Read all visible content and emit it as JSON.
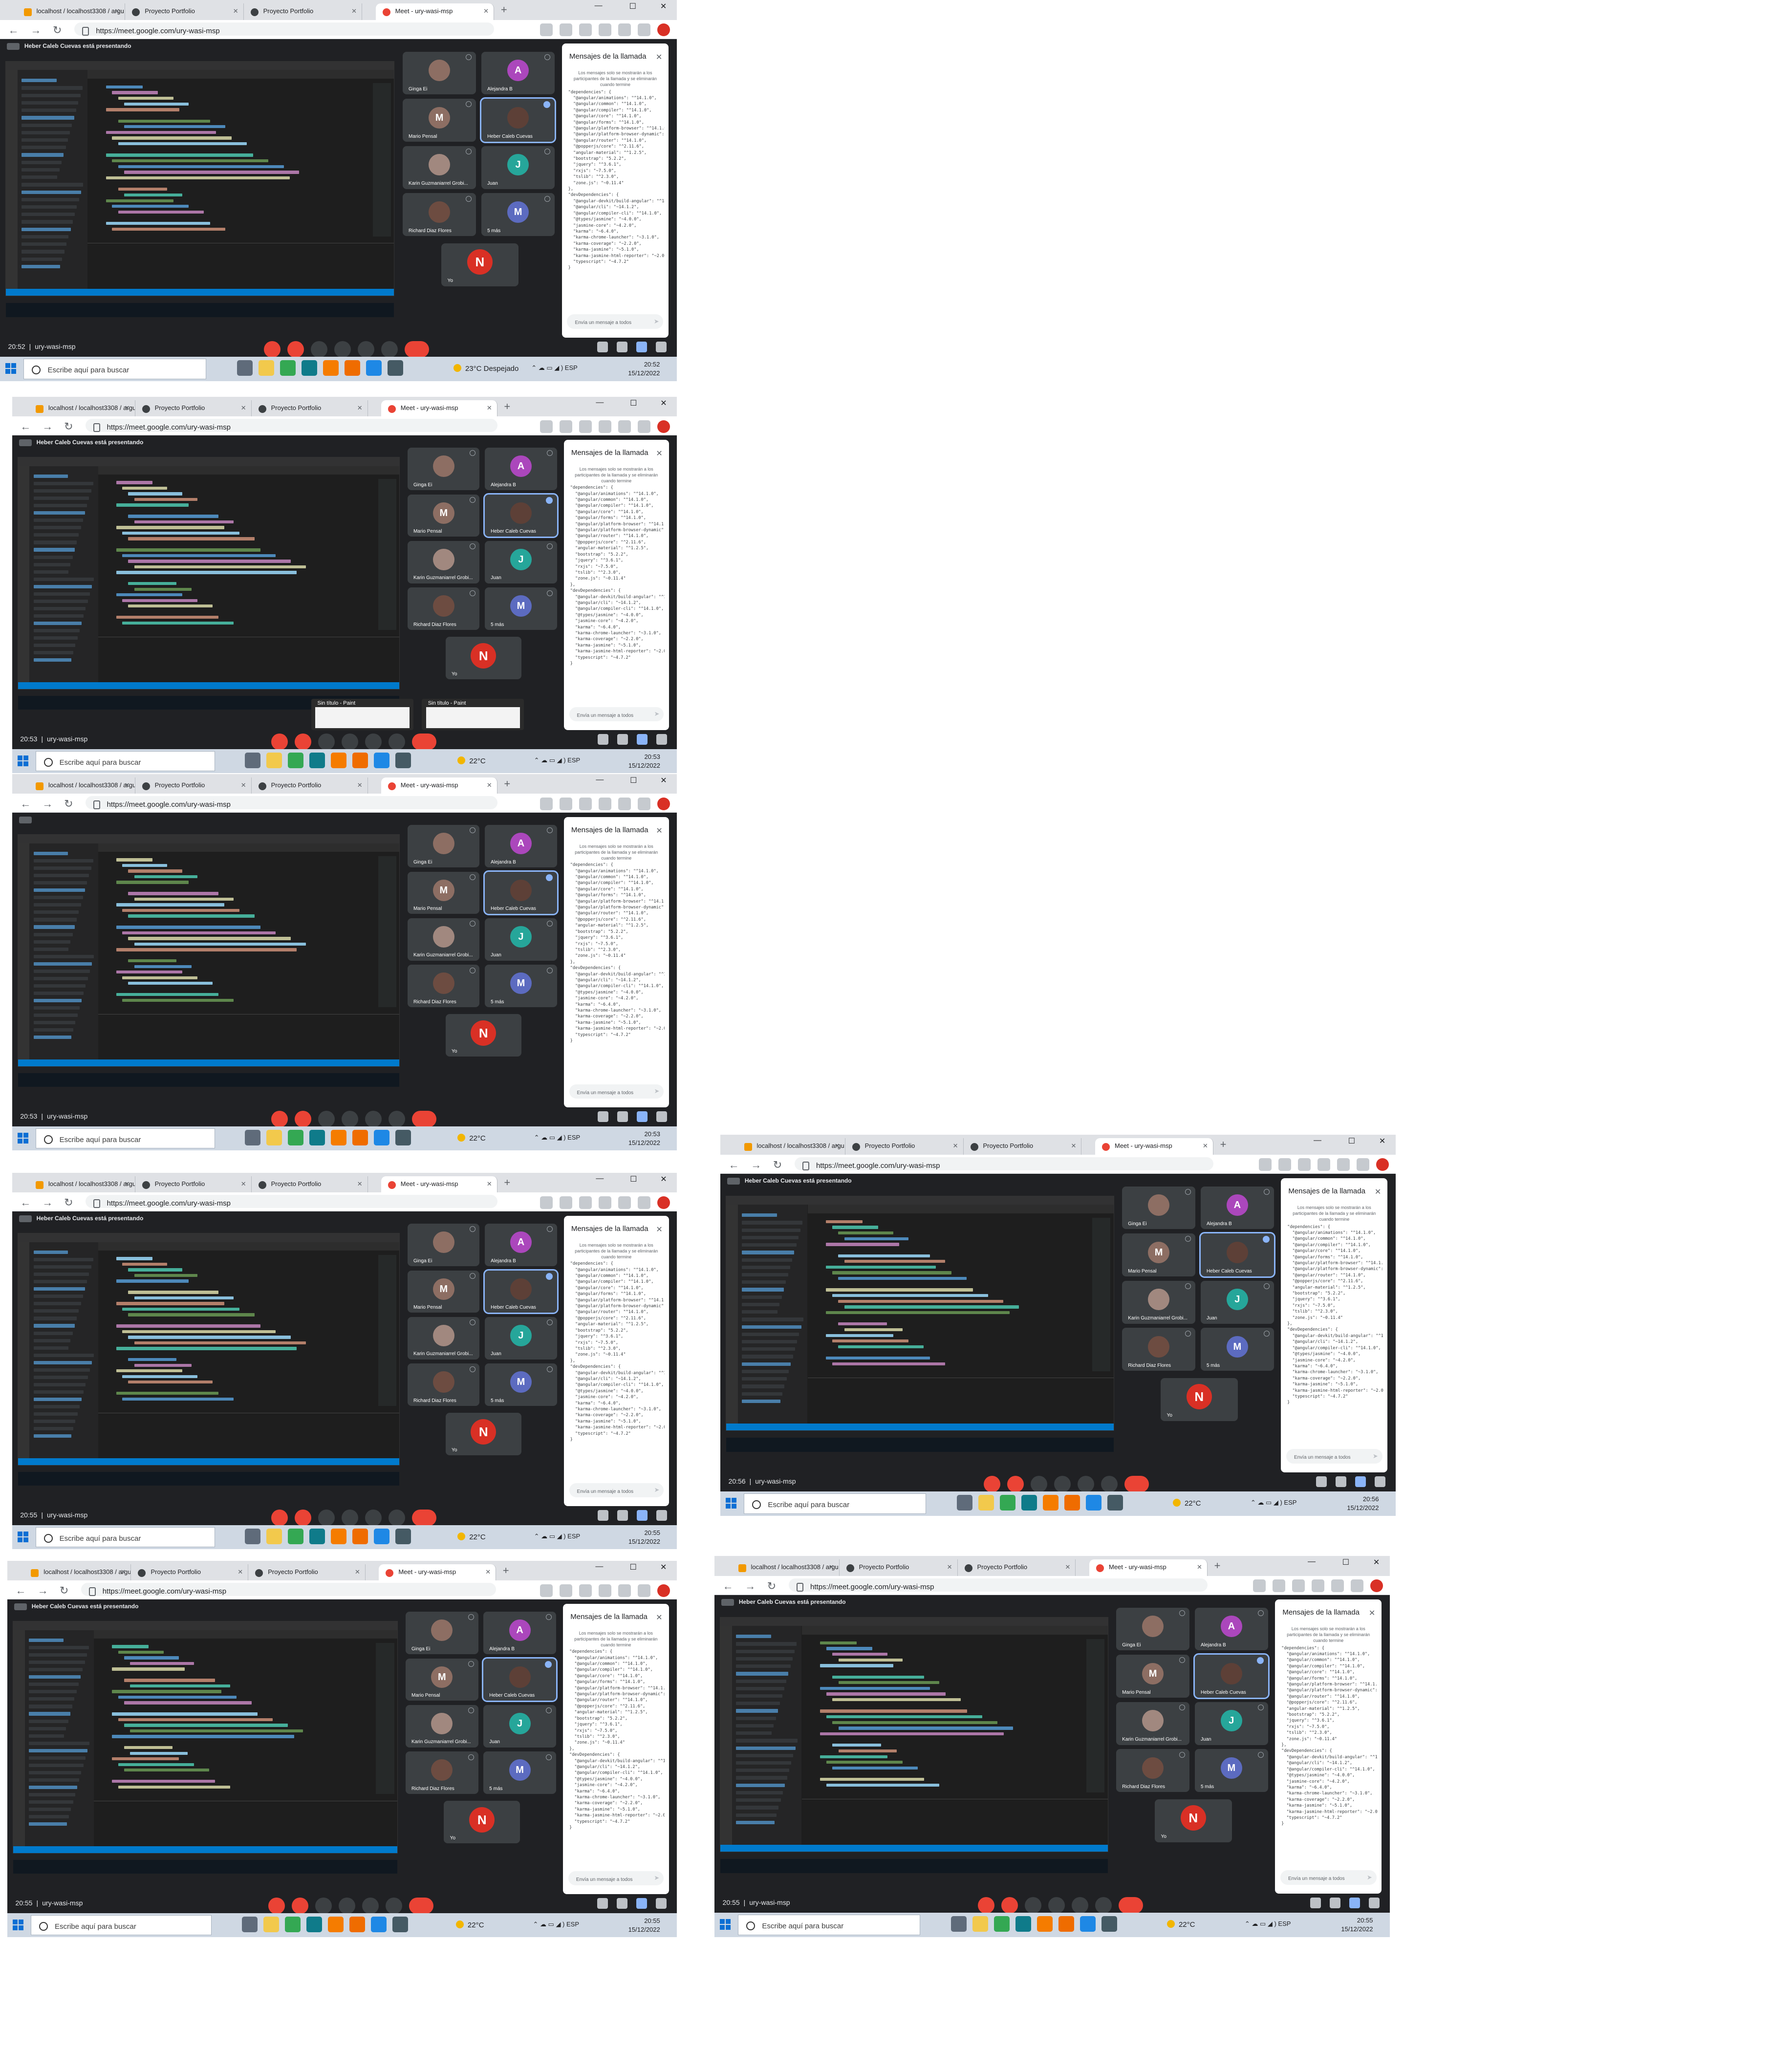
{
  "shots": [
    {
      "tabs": [
        "localhost / localhost3308 / argu",
        "Proyecto Portfolio",
        "Proyecto Portfolio",
        "Meet - ury-wasi-msp"
      ],
      "url": "https://meet.google.com/ury-wasi-msp",
      "presenter": "Heber Caleb Cuevas está presentando",
      "participants": [
        {
          "name": "Ginga Ei",
          "initial": "",
          "color": "#8d6e63"
        },
        {
          "name": "Alejandra B",
          "initial": "A",
          "color": "#ab47bc"
        },
        {
          "name": "Mario Pensal",
          "initial": "M",
          "color": "#8d6e63"
        },
        {
          "name": "Heber Caleb Cuevas",
          "initial": "",
          "color": "#5d4037"
        },
        {
          "name": "Karin Guzmaniarrel Grobi...",
          "initial": "",
          "color": "#a1887f"
        },
        {
          "name": "Juan",
          "initial": "J",
          "color": "#26a69a"
        },
        {
          "name": "Richard Diaz Flores",
          "initial": "",
          "color": "#6d4c41"
        },
        {
          "name": "5 más",
          "initial": "M",
          "color": "#5c6bc0"
        }
      ],
      "self": {
        "initial": "N",
        "name": "Yo"
      },
      "time": "20:52",
      "meeting_code": "ury-wasi-msp",
      "clock_time": "20:52",
      "clock_date": "15/12/2022",
      "weather": "23°C  Despejado",
      "lang": "ESP",
      "paint": []
    },
    {
      "tabs": [
        "localhost / localhost3308 / argu",
        "Proyecto Portfolio",
        "Proyecto Portfolio",
        "Meet - ury-wasi-msp"
      ],
      "url": "https://meet.google.com/ury-wasi-msp",
      "presenter": "Heber Caleb Cuevas está presentando",
      "participants": [
        {
          "name": "Ginga Ei",
          "initial": "",
          "color": "#8d6e63"
        },
        {
          "name": "Alejandra B",
          "initial": "A",
          "color": "#ab47bc"
        },
        {
          "name": "Mario Pensal",
          "initial": "M",
          "color": "#8d6e63"
        },
        {
          "name": "Heber Caleb Cuevas",
          "initial": "",
          "color": "#5d4037"
        },
        {
          "name": "Karin Guzmaniarrel Grobi...",
          "initial": "",
          "color": "#a1887f"
        },
        {
          "name": "Juan",
          "initial": "J",
          "color": "#26a69a"
        },
        {
          "name": "Richard Diaz Flores",
          "initial": "",
          "color": "#6d4c41"
        },
        {
          "name": "5 más",
          "initial": "M",
          "color": "#5c6bc0"
        }
      ],
      "self": {
        "initial": "N",
        "name": "Yo"
      },
      "time": "20:53",
      "meeting_code": "ury-wasi-msp",
      "clock_time": "20:53",
      "clock_date": "15/12/2022",
      "weather": "22°C",
      "lang": "ESP",
      "paint": [
        "Sin título - Paint",
        "Sin título - Paint"
      ]
    },
    {
      "tabs": [
        "localhost / localhost3308 / argu",
        "Proyecto Portfolio",
        "Proyecto Portfolio",
        "Meet - ury-wasi-msp"
      ],
      "url": "https://meet.google.com/ury-wasi-msp",
      "presenter": "",
      "participants": [
        {
          "name": "Ginga Ei",
          "initial": "",
          "color": "#8d6e63"
        },
        {
          "name": "Alejandra B",
          "initial": "A",
          "color": "#ab47bc"
        },
        {
          "name": "Mario Pensal",
          "initial": "M",
          "color": "#8d6e63"
        },
        {
          "name": "Heber Caleb Cuevas",
          "initial": "",
          "color": "#5d4037"
        },
        {
          "name": "Karin Guzmaniarrel Grobi...",
          "initial": "",
          "color": "#a1887f"
        },
        {
          "name": "Juan",
          "initial": "J",
          "color": "#26a69a"
        },
        {
          "name": "Richard Diaz Flores",
          "initial": "",
          "color": "#6d4c41"
        },
        {
          "name": "5 más",
          "initial": "M",
          "color": "#5c6bc0"
        }
      ],
      "self": {
        "initial": "N",
        "name": "Yo"
      },
      "time": "20:53",
      "meeting_code": "ury-wasi-msp",
      "clock_time": "20:53",
      "clock_date": "15/12/2022",
      "weather": "22°C",
      "lang": "ESP",
      "paint": []
    },
    {
      "tabs": [
        "localhost / localhost3308 / argu",
        "Proyecto Portfolio",
        "Proyecto Portfolio",
        "Meet - ury-wasi-msp"
      ],
      "url": "https://meet.google.com/ury-wasi-msp",
      "presenter": "Heber Caleb Cuevas está presentando",
      "participants": [
        {
          "name": "Ginga Ei",
          "initial": "",
          "color": "#8d6e63"
        },
        {
          "name": "Alejandra B",
          "initial": "A",
          "color": "#ab47bc"
        },
        {
          "name": "Mario Pensal",
          "initial": "M",
          "color": "#8d6e63"
        },
        {
          "name": "Heber Caleb Cuevas",
          "initial": "",
          "color": "#5d4037"
        },
        {
          "name": "Karin Guzmaniarrel Grobi...",
          "initial": "",
          "color": "#a1887f"
        },
        {
          "name": "Juan",
          "initial": "J",
          "color": "#26a69a"
        },
        {
          "name": "Richard Diaz Flores",
          "initial": "",
          "color": "#6d4c41"
        },
        {
          "name": "5 más",
          "initial": "M",
          "color": "#5c6bc0"
        }
      ],
      "self": {
        "initial": "N",
        "name": "Yo"
      },
      "time": "20:55",
      "meeting_code": "ury-wasi-msp",
      "clock_time": "20:55",
      "clock_date": "15/12/2022",
      "weather": "22°C",
      "lang": "ESP",
      "paint": []
    },
    {
      "tabs": [
        "localhost / localhost3308 / argu",
        "Proyecto Portfolio",
        "Proyecto Portfolio",
        "Meet - ury-wasi-msp"
      ],
      "url": "https://meet.google.com/ury-wasi-msp",
      "presenter": "Heber Caleb Cuevas está presentando",
      "participants": [
        {
          "name": "Ginga Ei",
          "initial": "",
          "color": "#8d6e63"
        },
        {
          "name": "Alejandra B",
          "initial": "A",
          "color": "#ab47bc"
        },
        {
          "name": "Mario Pensal",
          "initial": "M",
          "color": "#8d6e63"
        },
        {
          "name": "Heber Caleb Cuevas",
          "initial": "",
          "color": "#5d4037"
        },
        {
          "name": "Karin Guzmaniarrel Grobi...",
          "initial": "",
          "color": "#a1887f"
        },
        {
          "name": "Juan",
          "initial": "J",
          "color": "#26a69a"
        },
        {
          "name": "Richard Diaz Flores",
          "initial": "",
          "color": "#6d4c41"
        },
        {
          "name": "5 más",
          "initial": "M",
          "color": "#5c6bc0"
        }
      ],
      "self": {
        "initial": "N",
        "name": "Yo"
      },
      "time": "20:56",
      "meeting_code": "ury-wasi-msp",
      "clock_time": "20:56",
      "clock_date": "15/12/2022",
      "weather": "22°C",
      "lang": "ESP",
      "paint": []
    },
    {
      "tabs": [
        "localhost / localhost3308 / argu",
        "Proyecto Portfolio",
        "Proyecto Portfolio",
        "Meet - ury-wasi-msp"
      ],
      "url": "https://meet.google.com/ury-wasi-msp",
      "presenter": "Heber Caleb Cuevas está presentando",
      "participants": [
        {
          "name": "Ginga Ei",
          "initial": "",
          "color": "#8d6e63"
        },
        {
          "name": "Alejandra B",
          "initial": "A",
          "color": "#ab47bc"
        },
        {
          "name": "Mario Pensal",
          "initial": "M",
          "color": "#8d6e63"
        },
        {
          "name": "Heber Caleb Cuevas",
          "initial": "",
          "color": "#5d4037"
        },
        {
          "name": "Karin Guzmaniarrel Grobi...",
          "initial": "",
          "color": "#a1887f"
        },
        {
          "name": "Juan",
          "initial": "J",
          "color": "#26a69a"
        },
        {
          "name": "Richard Diaz Flores",
          "initial": "",
          "color": "#6d4c41"
        },
        {
          "name": "5 más",
          "initial": "M",
          "color": "#5c6bc0"
        }
      ],
      "self": {
        "initial": "N",
        "name": "Yo"
      },
      "time": "20:55",
      "meeting_code": "ury-wasi-msp",
      "clock_time": "20:55",
      "clock_date": "15/12/2022",
      "weather": "22°C",
      "lang": "ESP",
      "paint": []
    },
    {
      "tabs": [
        "localhost / localhost3308 / argu",
        "Proyecto Portfolio",
        "Proyecto Portfolio",
        "Meet - ury-wasi-msp"
      ],
      "url": "https://meet.google.com/ury-wasi-msp",
      "presenter": "Heber Caleb Cuevas está presentando",
      "participants": [
        {
          "name": "Ginga Ei",
          "initial": "",
          "color": "#8d6e63"
        },
        {
          "name": "Alejandra B",
          "initial": "A",
          "color": "#ab47bc"
        },
        {
          "name": "Mario Pensal",
          "initial": "M",
          "color": "#8d6e63"
        },
        {
          "name": "Heber Caleb Cuevas",
          "initial": "",
          "color": "#5d4037"
        },
        {
          "name": "Karin Guzmaniarrel Grobi...",
          "initial": "",
          "color": "#a1887f"
        },
        {
          "name": "Juan",
          "initial": "J",
          "color": "#26a69a"
        },
        {
          "name": "Richard Diaz Flores",
          "initial": "",
          "color": "#6d4c41"
        },
        {
          "name": "5 más",
          "initial": "M",
          "color": "#5c6bc0"
        }
      ],
      "self": {
        "initial": "N",
        "name": "Yo"
      },
      "time": "20:55",
      "meeting_code": "ury-wasi-msp",
      "clock_time": "20:55",
      "clock_date": "15/12/2022",
      "weather": "22°C",
      "lang": "ESP",
      "paint": []
    }
  ],
  "chat": {
    "title": "Mensajes de la llamada",
    "note": "Los mensajes solo se mostrarán a los participantes de la llamada y se eliminarán cuando termine",
    "body": "\"dependencies\": {\n  \"@angular/animations\": \"^14.1.0\",\n  \"@angular/common\": \"^14.1.0\",\n  \"@angular/compiler\": \"^14.1.0\",\n  \"@angular/core\": \"^14.1.0\",\n  \"@angular/forms\": \"^14.1.0\",\n  \"@angular/platform-browser\": \"^14.1.0\",\n  \"@angular/platform-browser-dynamic\": \"^14.1.0\",\n  \"@angular/router\": \"^14.1.0\",\n  \"@popperjs/core\": \"^2.11.6\",\n  \"angular-material\": \"^1.2.5\",\n  \"bootstrap\": \"5.2.2\",\n  \"jquery\": \"^3.6.1\",\n  \"rxjs\": \"~7.5.0\",\n  \"tslib\": \"^2.3.0\",\n  \"zone.js\": \"~0.11.4\"\n},\n\"devDependencies\": {\n  \"@angular-devkit/build-angular\": \"^14.1.2\",\n  \"@angular/cli\": \"~14.1.2\",\n  \"@angular/compiler-cli\": \"^14.1.0\",\n  \"@types/jasmine\": \"~4.0.0\",\n  \"jasmine-core\": \"~4.2.0\",\n  \"karma\": \"~6.4.0\",\n  \"karma-chrome-launcher\": \"~3.1.0\",\n  \"karma-coverage\": \"~2.2.0\",\n  \"karma-jasmine\": \"~5.1.0\",\n  \"karma-jasmine-html-reporter\": \"~2.0.0\",\n  \"typescript\": \"~4.7.2\"\n}",
    "input_placeholder": "Envía un mensaje a todos"
  },
  "taskbar": {
    "search_placeholder": "Escribe aquí para buscar"
  }
}
